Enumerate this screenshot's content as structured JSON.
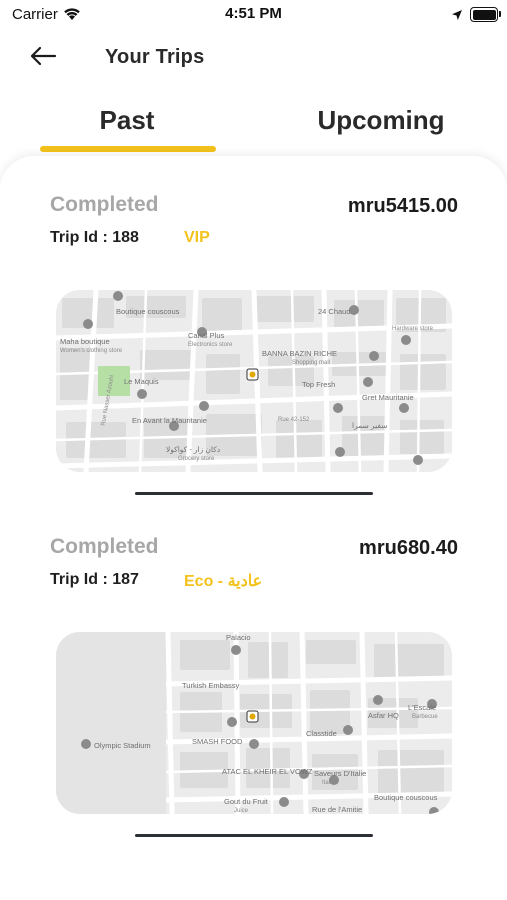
{
  "status_bar": {
    "carrier": "Carrier",
    "time": "4:51 PM"
  },
  "header": {
    "title": "Your Trips",
    "back_icon": "arrow-left-icon"
  },
  "tabs": [
    {
      "label": "Past",
      "active": true
    },
    {
      "label": "Upcoming",
      "active": false
    }
  ],
  "colors": {
    "accent": "#f3c21b",
    "status_text": "#a7a7a7",
    "divider": "#2c2f33"
  },
  "trips": [
    {
      "status": "Completed",
      "price": "mru5415.00",
      "trip_id": "Trip Id : 188",
      "ride_class": "VIP",
      "map_labels": [
        "Boutique couscous",
        "Canal Plus",
        "Electronics store",
        "24 Chaud",
        "Hardware store",
        "Maha boutique",
        "Women's clothing store",
        "BANNA BAZIN RICHE",
        "Shopping mall",
        "Le Maquis",
        "Top Fresh",
        "Gret Mauritanie",
        "En Avant la Mauritanie",
        "Rue 42-152",
        "Rue Nasser Azouhi",
        "دكان زار - كواكولا",
        "Grocery store",
        "سفير سمرا"
      ]
    },
    {
      "status": "Completed",
      "price": "mru680.40",
      "trip_id": "Trip Id : 187",
      "ride_class": "Eco - عادية",
      "map_labels": [
        "Palacio",
        "Turkish Embassy",
        "SMASH FOOD",
        "Asfar HQ",
        "L'Escale",
        "Barbecue",
        "Olympic Stadium",
        "Classtide",
        "ATAC EL KHEIR EL VOWZ",
        "Saveurs D'Italie",
        "Italian",
        "Gout du Fruit",
        "Juice",
        "Rue de l'Amitie",
        "Boutique couscous"
      ]
    }
  ]
}
